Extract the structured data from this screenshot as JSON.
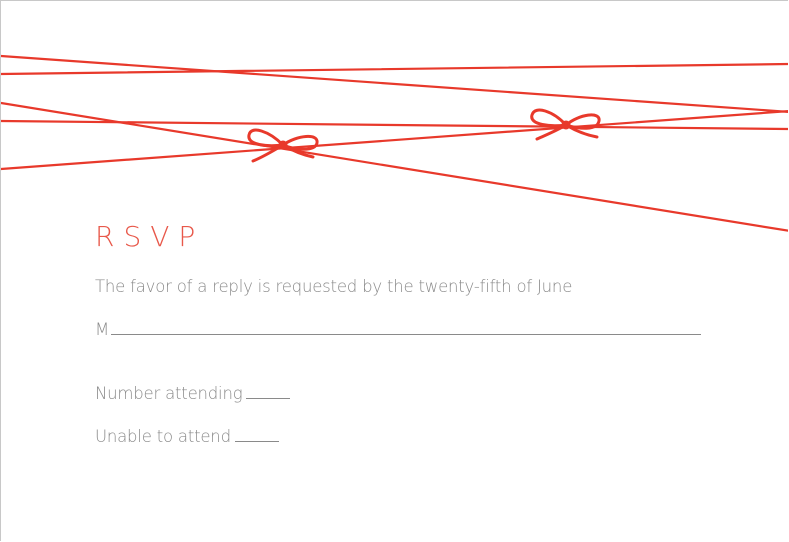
{
  "colors": {
    "accent": "#e8392b",
    "title": "#e8584a",
    "text": "#8a8a8a"
  },
  "card": {
    "title": "RSVP",
    "request_line": "The favor of a reply is requested by the twenty-fifth of June",
    "name_prefix": "M",
    "number_attending_label": "Number attending",
    "unable_label": "Unable to attend"
  }
}
